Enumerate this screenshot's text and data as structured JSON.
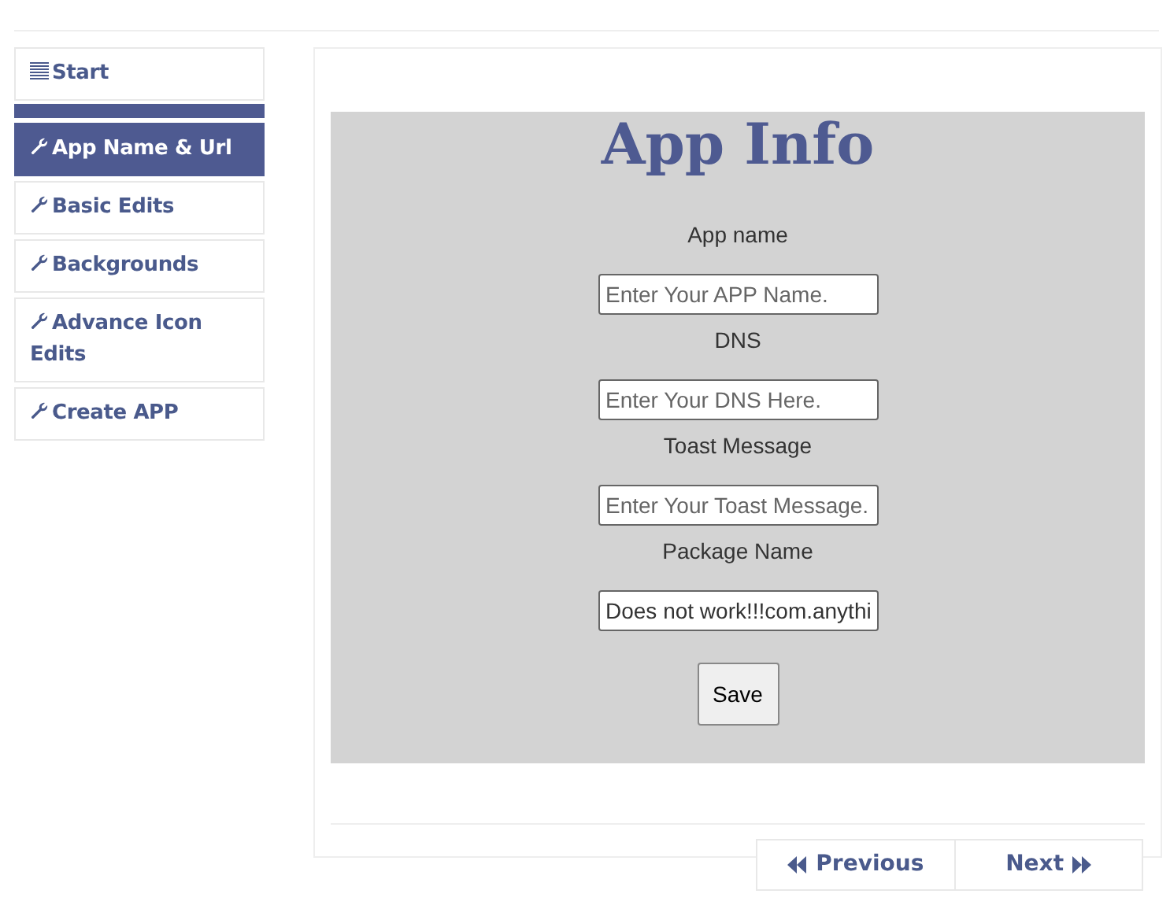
{
  "sidebar": {
    "items": [
      {
        "label": "Start",
        "kind": "start",
        "selected": false
      },
      {
        "label": "App Name & Url",
        "kind": "tool",
        "selected": true
      },
      {
        "label": "Basic Edits",
        "kind": "tool",
        "selected": false
      },
      {
        "label": "Backgrounds",
        "kind": "tool",
        "selected": false
      },
      {
        "label": "Advance Icon Edits",
        "kind": "tool",
        "selected": false
      },
      {
        "label": "Create APP",
        "kind": "tool",
        "selected": false
      }
    ]
  },
  "form": {
    "title": "App Info",
    "fields": [
      {
        "label": "App name",
        "placeholder": "Enter Your APP Name."
      },
      {
        "label": "DNS",
        "placeholder": "Enter Your DNS Here."
      },
      {
        "label": "Toast Message",
        "placeholder": "Enter Your Toast Message."
      },
      {
        "label": "Package Name",
        "value": "Does not work!!!com.anythi"
      }
    ],
    "save": "Save"
  },
  "pager": [
    {
      "label": "Previous",
      "kind": "prev"
    },
    {
      "label": "Next",
      "kind": "next"
    }
  ]
}
